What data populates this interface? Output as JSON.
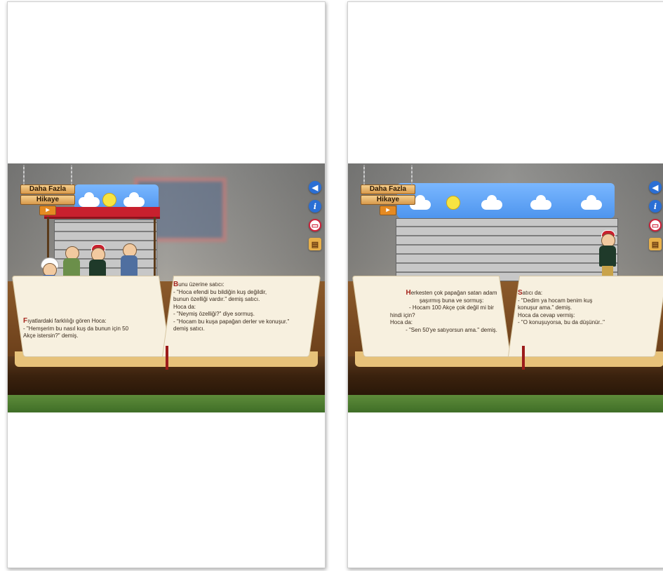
{
  "left_page": {
    "sign": {
      "line1": "Daha Fazla",
      "line2": "Hikaye",
      "button": "▸"
    },
    "text_left": {
      "drop": "F",
      "p1": "ıyatlardaki farklılığı gören Hoca:",
      "p2": "- \"Hemşerim bu nasıl kuş da bunun için 50",
      "p3": "Akçe istersin?\" demiş."
    },
    "text_right": {
      "drop": "B",
      "p1": "unu  üzerine satıcı:",
      "p2": "- \"Hoca efendi bu bildiğin kuş değildir,",
      "p3": "bunun özelliği vardır.\" demiş satıcı.",
      "p4": "Hoca da:",
      "p5": "- \"Neymiş özelliği?\" diye sormuş.",
      "p6": "- \"Hocam bu kuşa papağan derler ve konuşur.\"",
      "p7": "demiş satıcı."
    }
  },
  "right_page": {
    "sign": {
      "line1": "Daha Fazla",
      "line2": "Hikaye",
      "button": "▸"
    },
    "text_left": {
      "drop": "H",
      "p1": "erkesten çok papağan satan adam",
      "p2": "şaşırmış buna ve sormuş:",
      "p3": "- Hocam 100 Akçe çok değil mi bir",
      "p4": "hindi için?",
      "p5": "Hoca da:",
      "p6": "- \"Sen 50'ye satıyorsun ama.\" demiş."
    },
    "text_right": {
      "drop": "S",
      "p1": "atıcı da:",
      "p2": "- \"Dedim ya hocam benim kuş",
      "p3": "konuşur ama.\" demiş.",
      "p4": "Hoca da cevap vermiş:",
      "p5": "- \"O konuşuyorsa, bu da düşünür..\""
    }
  },
  "tools": {
    "sound_icon": "speaker-icon",
    "info_label": "i",
    "stop_icon": "stop-icon",
    "basket_icon": "basket-icon"
  },
  "colors": {
    "accent_red": "#a4241c",
    "tool_blue": "#2b6fd4"
  }
}
